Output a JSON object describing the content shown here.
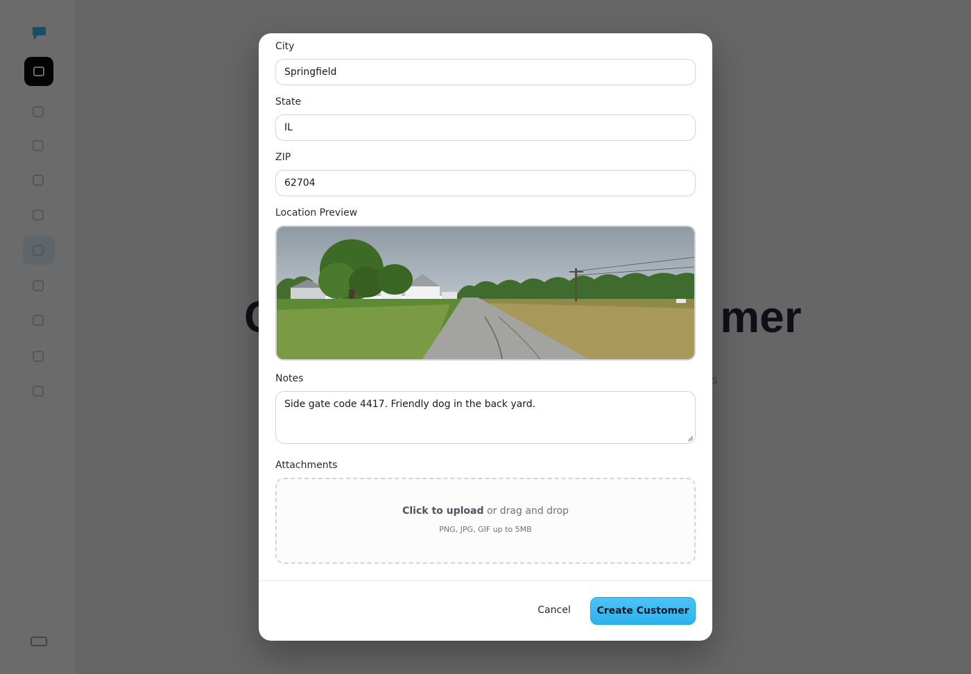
{
  "background": {
    "page_title_fragment_left": "C",
    "page_title_fragment_right": "mer",
    "subtitle_fragment": "rs"
  },
  "modal": {
    "fields": {
      "city": {
        "label": "City",
        "value": "Springfield"
      },
      "state": {
        "label": "State",
        "value": "IL"
      },
      "zip": {
        "label": "ZIP",
        "value": "62704"
      }
    },
    "location_preview": {
      "label": "Location Preview"
    },
    "notes": {
      "label": "Notes",
      "value": "Side gate code 4417. Friendly dog in the back yard."
    },
    "attachments": {
      "label": "Attachments",
      "upload_link": "Click to upload",
      "upload_rest": "or drag and drop",
      "hint": "PNG, JPG, GIF up to 5MB"
    },
    "buttons": {
      "cancel": "Cancel",
      "create": "Create Customer"
    }
  },
  "colors": {
    "accent": "#38bdf8",
    "overlay": "#000000"
  }
}
